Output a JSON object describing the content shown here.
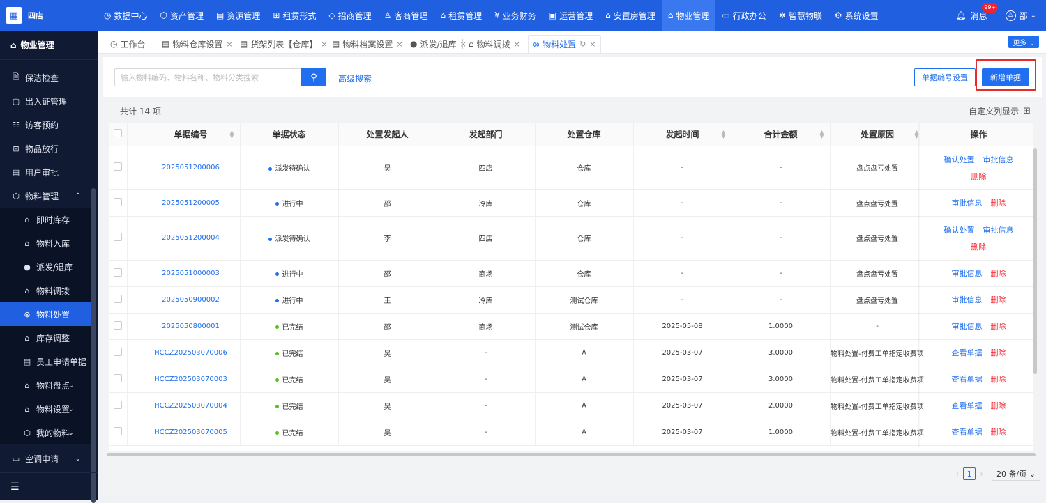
{
  "app": {
    "logo_text": "四店"
  },
  "topnav": [
    {
      "icon": "◷",
      "label": "数据中心"
    },
    {
      "icon": "⬡",
      "label": "资产管理"
    },
    {
      "icon": "▤",
      "label": "资源管理"
    },
    {
      "icon": "⊞",
      "label": "租赁形式"
    },
    {
      "icon": "◇",
      "label": "招商管理"
    },
    {
      "icon": "♙",
      "label": "客商管理"
    },
    {
      "icon": "⌂",
      "label": "租赁管理"
    },
    {
      "icon": "¥",
      "label": "业务财务"
    },
    {
      "icon": "▣",
      "label": "运营管理"
    },
    {
      "icon": "⌂",
      "label": "安置房管理"
    },
    {
      "icon": "⌂",
      "label": "物业管理"
    },
    {
      "icon": "▭",
      "label": "行政办公"
    },
    {
      "icon": "✲",
      "label": "智慧物联"
    },
    {
      "icon": "⚙",
      "label": "系统设置"
    }
  ],
  "topright": {
    "messages_label": "消息",
    "messages_badge": "99+",
    "user_name": "邵"
  },
  "sidebar": {
    "title": "物业管理",
    "items": [
      {
        "icon": "🗎",
        "label": "保洁检查"
      },
      {
        "icon": "▢",
        "label": "出入证管理"
      },
      {
        "icon": "☷",
        "label": "访客预约"
      },
      {
        "icon": "⊡",
        "label": "物品放行"
      },
      {
        "icon": "▤",
        "label": "用户审批"
      },
      {
        "icon": "⬡",
        "label": "物料管理",
        "arrow": "⌃"
      },
      {
        "icon": "⌂",
        "label": "即时库存"
      },
      {
        "icon": "⌂",
        "label": "物料入库"
      },
      {
        "icon": "●",
        "label": "派发/退库"
      },
      {
        "icon": "⌂",
        "label": "物料调拨"
      },
      {
        "icon": "⊗",
        "label": "物料处置"
      },
      {
        "icon": "⌂",
        "label": "库存调整"
      },
      {
        "icon": "▤",
        "label": "员工申请单据"
      },
      {
        "icon": "⌂",
        "label": "物料盘点",
        "arrow": "⌄"
      },
      {
        "icon": "⌂",
        "label": "物料设置",
        "arrow": "⌄"
      },
      {
        "icon": "⬡",
        "label": "我的物料",
        "arrow": "⌄"
      },
      {
        "icon": "▭",
        "label": "空调申请",
        "arrow": "⌄"
      }
    ],
    "collapse_icon": "☰"
  },
  "tabs": [
    {
      "icon": "◷",
      "label": "工作台",
      "close": ""
    },
    {
      "icon": "▤",
      "label": "物料仓库设置",
      "close": "×"
    },
    {
      "icon": "▤",
      "label": "货架列表【仓库】",
      "close": "×"
    },
    {
      "icon": "▤",
      "label": "物料档案设置",
      "close": "×"
    },
    {
      "icon": "●",
      "label": "派发/退库",
      "close": "×"
    },
    {
      "icon": "⌂",
      "label": "物料调拨",
      "close": "×"
    },
    {
      "icon": "⊗",
      "label": "物料处置",
      "close": "×",
      "refresh": "↻"
    }
  ],
  "more_label": "更多 ⌄",
  "toolbar": {
    "search_placeholder": "输入物料编码、物料名称、物料分类搜索",
    "search_icon": "⚲",
    "advanced_search": "高级搜索",
    "number_settings": "单据编号设置",
    "add_bill": "新增单据"
  },
  "table_meta": {
    "total": "共计 14 项",
    "custom_columns": "自定义列显示",
    "grid_icon": "⊞"
  },
  "columns": [
    "单据编号",
    "单据状态",
    "处置发起人",
    "发起部门",
    "处置仓库",
    "发起时间",
    "合计金额",
    "处置原因",
    "操作"
  ],
  "status_colors": {
    "派发待确认": "#1f6ff0",
    "进行中": "#1f6ff0",
    "已完结": "#52c41a"
  },
  "rows": [
    {
      "code": "2025051200006",
      "status": "派发待确认",
      "initiator": "吴",
      "dept": "四店",
      "warehouse": "仓库",
      "time": "-",
      "amount": "-",
      "reason": "盘点盘亏处置",
      "actions": [
        "确认处置",
        "审批信息",
        "删除"
      ],
      "tall": true
    },
    {
      "code": "2025051200005",
      "status": "进行中",
      "initiator": "邵",
      "dept": "冷库",
      "warehouse": "仓库",
      "time": "-",
      "amount": "-",
      "reason": "盘点盘亏处置",
      "actions": [
        "审批信息",
        "删除"
      ]
    },
    {
      "code": "2025051200004",
      "status": "派发待确认",
      "initiator": "李",
      "dept": "四店",
      "warehouse": "仓库",
      "time": "-",
      "amount": "-",
      "reason": "盘点盘亏处置",
      "actions": [
        "确认处置",
        "审批信息",
        "删除"
      ],
      "tall": true
    },
    {
      "code": "2025051000003",
      "status": "进行中",
      "initiator": "邵",
      "dept": "商场",
      "warehouse": "仓库",
      "time": "-",
      "amount": "-",
      "reason": "盘点盘亏处置",
      "actions": [
        "审批信息",
        "删除"
      ]
    },
    {
      "code": "2025050900002",
      "status": "进行中",
      "initiator": "王",
      "dept": "冷库",
      "warehouse": "测试仓库",
      "time": "-",
      "amount": "-",
      "reason": "盘点盘亏处置",
      "actions": [
        "审批信息",
        "删除"
      ]
    },
    {
      "code": "2025050800001",
      "status": "已完结",
      "initiator": "邵",
      "dept": "商场",
      "warehouse": "测试仓库",
      "time": "2025-05-08",
      "amount": "1.0000",
      "reason": "-",
      "actions": [
        "审批信息",
        "删除"
      ]
    },
    {
      "code": "HCCZ202503070006",
      "status": "已完结",
      "initiator": "吴",
      "dept": "-",
      "warehouse": "A",
      "time": "2025-03-07",
      "amount": "3.0000",
      "reason": "物料处置-付费工单指定收费项",
      "actions": [
        "查看单据",
        "删除"
      ]
    },
    {
      "code": "HCCZ202503070003",
      "status": "已完结",
      "initiator": "吴",
      "dept": "-",
      "warehouse": "A",
      "time": "2025-03-07",
      "amount": "3.0000",
      "reason": "物料处置-付费工单指定收费项",
      "actions": [
        "查看单据",
        "删除"
      ]
    },
    {
      "code": "HCCZ202503070004",
      "status": "已完结",
      "initiator": "吴",
      "dept": "-",
      "warehouse": "A",
      "time": "2025-03-07",
      "amount": "2.0000",
      "reason": "物料处置-付费工单指定收费项",
      "actions": [
        "查看单据",
        "删除"
      ]
    },
    {
      "code": "HCCZ202503070005",
      "status": "已完结",
      "initiator": "吴",
      "dept": "-",
      "warehouse": "A",
      "time": "2025-03-07",
      "amount": "1.0000",
      "reason": "物料处置-付费工单指定收费项",
      "actions": [
        "查看单据",
        "删除"
      ]
    }
  ],
  "pager": {
    "prev": "‹",
    "page": "1",
    "next": "›",
    "page_size": "20 条/页 ⌄"
  }
}
